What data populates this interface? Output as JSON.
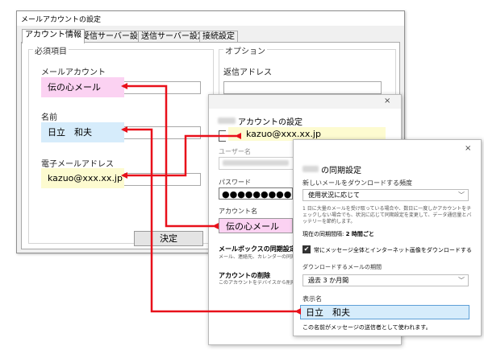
{
  "dialog1": {
    "title": "メールアカウントの設定",
    "tabs": [
      "アカウント情報",
      "受信サーバー設定",
      "送信サーバー設定",
      "接続設定"
    ],
    "required_group": "必須項目",
    "option_group": "オプション",
    "mail_account_label": "メールアカウント",
    "mail_account_value": "伝の心メール",
    "name_label": "名前",
    "name_value": "日立　和夫",
    "email_label": "電子メールアドレス",
    "email_value": "kazuo@xxx.xx.jp",
    "reply_label": "返信アドレス",
    "ok_button": "決定"
  },
  "dialog2": {
    "title_suffix": "アカウントの設定",
    "email_value": "kazuo@xxx.xx.jp",
    "username_label": "ユーザー名",
    "password_label": "パスワード",
    "password_value": "●●●●●●●●●●",
    "account_name_label": "アカウント名",
    "account_name_value": "伝の心メール",
    "sync_heading": "メールボックスの同期設定を変",
    "sync_desc": "メール、連絡先、カレンダーの同期に関",
    "delete_heading": "アカウントの削除",
    "delete_desc": "このアカウントをデバイスから削除しま",
    "close_icon": "×"
  },
  "dialog3": {
    "title_suffix": "の同期設定",
    "new_mail_label": "新しいメールをダウンロードする頻度",
    "freq_value": "使用状況に応じて",
    "info_text": "1 日に大量のメールを受け取っている場合や、数日に一度しかアカウントをチェックしない場合でも、状況に応じて同期設定を変更して、データ通信量とバッテリーを節約します。",
    "current_label": "現在の同期間隔: ",
    "current_value": "2 時間ごと",
    "checkbox_label": "常にメッセージ全体とインターネット画像をダウンロードする",
    "period_label": "ダウンロードするメールの期間",
    "period_value": "過去 3 か月間",
    "display_name_label": "表示名",
    "display_name_value": "日立　和夫",
    "footer_text": "この名前がメッセージの送信者として使われます。",
    "close_icon": "×",
    "chevron": "﹀",
    "check": "✔"
  },
  "colors": {
    "arrow": "#e8101a",
    "pink": "#fbd2f2",
    "blue": "#d6ecfb",
    "yellow": "#fdfbd0"
  }
}
